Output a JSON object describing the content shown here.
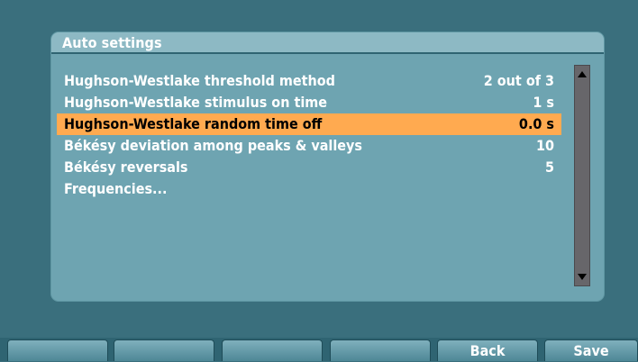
{
  "panel": {
    "title": "Auto settings"
  },
  "settings": [
    {
      "label": "Hughson-Westlake threshold method",
      "value": "2 out of 3",
      "selected": false
    },
    {
      "label": "Hughson-Westlake stimulus on time",
      "value": "1 s",
      "selected": false
    },
    {
      "label": "Hughson-Westlake random time off",
      "value": "0.0 s",
      "selected": true
    },
    {
      "label": "Békésy deviation among peaks & valleys",
      "value": "10",
      "selected": false
    },
    {
      "label": "Békésy reversals",
      "value": "5",
      "selected": false
    },
    {
      "label": "Frequencies...",
      "value": "",
      "selected": false
    }
  ],
  "softkeys": [
    {
      "label": ""
    },
    {
      "label": ""
    },
    {
      "label": ""
    },
    {
      "label": ""
    },
    {
      "label": "Back"
    },
    {
      "label": "Save"
    }
  ],
  "colors": {
    "background": "#3a6f7d",
    "panel": "#6ea4b1",
    "selection": "#ffaa50",
    "scrollbar": "#67666a"
  },
  "icons": {
    "scroll_up": "triangle-up-icon",
    "scroll_down": "triangle-down-icon"
  }
}
